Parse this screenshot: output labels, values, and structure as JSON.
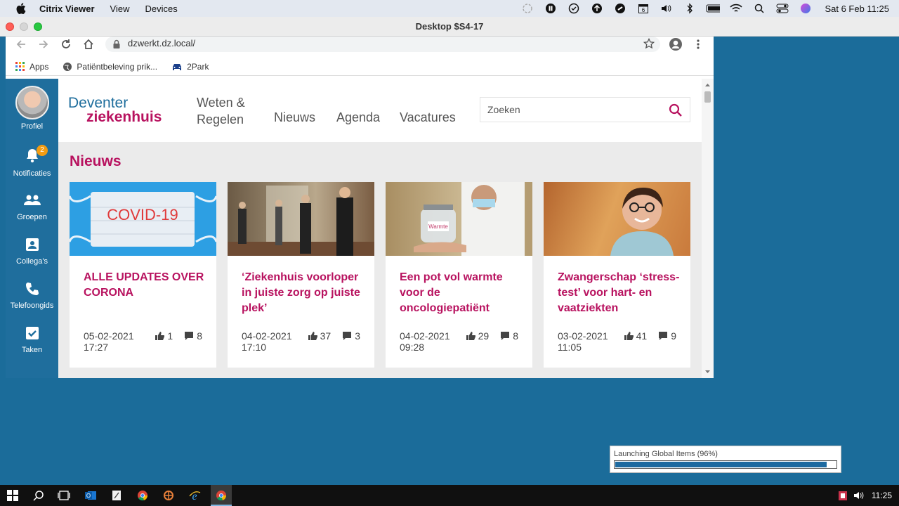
{
  "mac_menubar": {
    "app_name": "Citrix Viewer",
    "menus": [
      "View",
      "Devices"
    ],
    "datetime": "Sat 6 Feb  11:25"
  },
  "citrix_window": {
    "title": "Desktop $S4-17"
  },
  "browser": {
    "url": "dzwerkt.dz.local/",
    "bookmarks": [
      "Apps",
      "Patiëntbeleving prik...",
      "2Park"
    ]
  },
  "sidebar": {
    "items": [
      {
        "label": "Profiel"
      },
      {
        "label": "Notificaties",
        "badge": "2"
      },
      {
        "label": "Groepen"
      },
      {
        "label": "Collega's"
      },
      {
        "label": "Telefoongids"
      },
      {
        "label": "Taken"
      }
    ]
  },
  "header": {
    "logo_line1": "Deventer",
    "logo_line2": "ziekenhuis",
    "nav": [
      "Weten &",
      "Regelen",
      "Nieuws",
      "Agenda",
      "Vacatures"
    ],
    "search_placeholder": "Zoeken"
  },
  "news": {
    "title": "Nieuws",
    "cards": [
      {
        "image_text": "COVID-19",
        "title": "ALLE UPDATES OVER CORONA",
        "date": "05-02-2021 17:27",
        "likes": "1",
        "comments": "8"
      },
      {
        "title": "‘Ziekenhuis voorloper in juiste zorg op juiste plek’",
        "date": "04-02-2021 17:10",
        "likes": "37",
        "comments": "3"
      },
      {
        "image_text": "Warmte",
        "title": "Een pot vol warmte voor de oncologiepatiënt",
        "date": "04-02-2021 09:28",
        "likes": "29",
        "comments": "8"
      },
      {
        "title": "Zwangerschap ‘stress-test’ voor hart- en vaatziekten",
        "date": "03-02-2021 11:05",
        "likes": "41",
        "comments": "9"
      }
    ]
  },
  "progress": {
    "label": "Launching Global Items (96%)",
    "value": 0.96
  },
  "taskbar": {
    "time": "11:25"
  },
  "colors": {
    "brand_magenta": "#b8125f",
    "brand_blue": "#1f6e9d",
    "desktop_bg": "#1b6c9a"
  }
}
